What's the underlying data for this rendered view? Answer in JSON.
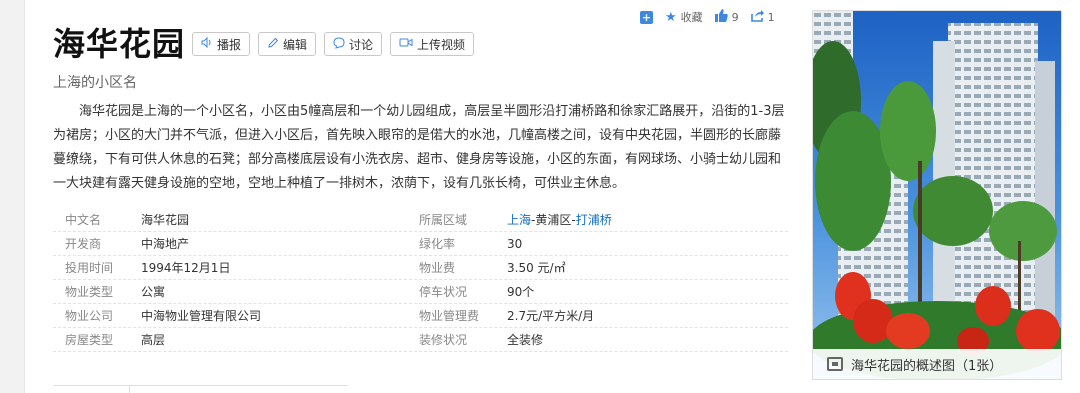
{
  "actions": {
    "collect_label": "收藏",
    "like_count": "9",
    "share_count": "1"
  },
  "title": "海华花园",
  "tools": {
    "broadcast": "播报",
    "edit": "编辑",
    "discuss": "讨论",
    "upload_video": "上传视频"
  },
  "subtitle": "上海的小区名",
  "summary": "海华花园是上海的一个小区名，小区由5幢高层和一个幼儿园组成，高层呈半圆形沿打浦桥路和徐家汇路展开，沿街的1-3层为裙房；小区的大门并不气派，但进入小区后，首先映入眼帘的是偌大的水池，几幢高楼之间，设有中央花园，半圆形的长廊藤蔓缭绕，下有可供人休息的石凳；部分高楼底层设有小洗衣房、超市、健身房等设施，小区的东面，有网球场、小骑士幼儿园和一大块建有露天健身设施的空地，空地上种植了一排树木，浓荫下，设有几张长椅，可供业主休息。",
  "info": {
    "rows": [
      {
        "k1": "中文名",
        "v1": "海华花园",
        "k2": "所属区域",
        "v2a": "上海",
        "v2b": "-黄浦区-",
        "v2c": "打浦桥"
      },
      {
        "k1": "开发商",
        "v1": "中海地产",
        "k2": "绿化率",
        "v2": "30"
      },
      {
        "k1": "投用时间",
        "v1": "1994年12月1日",
        "k2": "物业费",
        "v2": "3.50 元/㎡"
      },
      {
        "k1": "物业类型",
        "v1": "公寓",
        "k2": "停车状况",
        "v2": "90个"
      },
      {
        "k1": "物业公司",
        "v1": "中海物业管理有限公司",
        "k2": "物业管理费",
        "v2": "2.7元/平方米/月"
      },
      {
        "k1": "房屋类型",
        "v1": "高层",
        "k2": "装修状况",
        "v2": "全装修"
      }
    ]
  },
  "photo": {
    "caption": "海华花园的概述图（1张）"
  },
  "colors": {
    "accent": "#3f88e0",
    "link": "#136ec2"
  }
}
